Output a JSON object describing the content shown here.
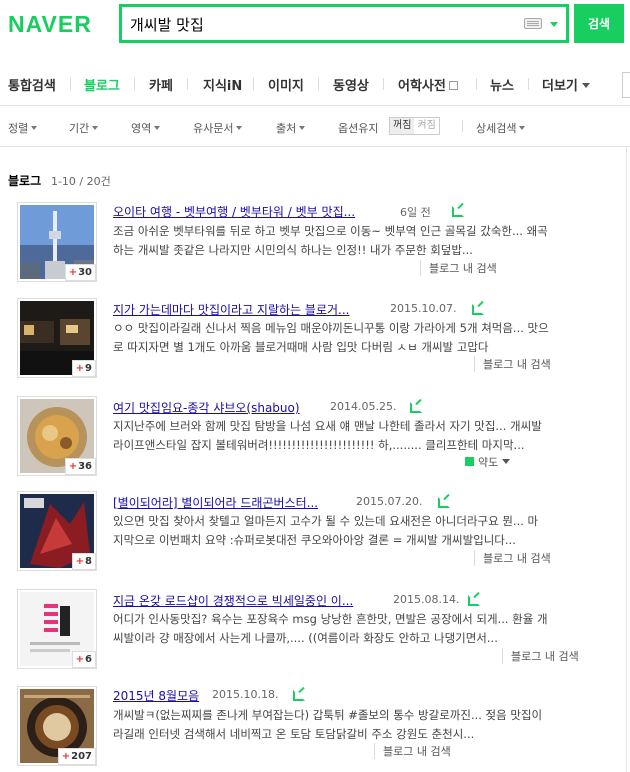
{
  "header": {
    "logo": "NAVER",
    "query": "개씨발 맛집",
    "search_button": "검색"
  },
  "tabs": [
    {
      "label": "통합검색"
    },
    {
      "label": "블로그",
      "active": true
    },
    {
      "label": "카페"
    },
    {
      "label": "지식iN"
    },
    {
      "label": "이미지"
    },
    {
      "label": "동영상"
    },
    {
      "label": "어학사전"
    },
    {
      "label": "뉴스"
    },
    {
      "label": "더보기"
    }
  ],
  "filters": {
    "sort": "정렬",
    "period": "기간",
    "area": "영역",
    "similar": "유사문서",
    "source": "출처",
    "option_label": "옵션유지",
    "option_off": "꺼짐",
    "option_on": "켜짐",
    "detail": "상세검색"
  },
  "section": {
    "title": "블로그",
    "count": "1-10 / 20건"
  },
  "results": [
    {
      "title": "오이타 여행 - 벳부여행 / 벳부타워 / 벳부 맛집...",
      "date": "6일 전",
      "desc1": "조금 아쉬운 벳부타워를 뒤로 하고 벳부 맛집으로 이동~ 벳부역 인근 골목길 갔숙한... 왜곡",
      "desc2": "하는 개씨발 좃같은 나라지만 시민의식 하나는 인정!! 내가 주문한 회덮밥...",
      "link": "블로그 내 검색",
      "count": "30"
    },
    {
      "title": "지가 가는데마다 맛집이라고 지랄하는 블로거...",
      "date": "2015.10.07.",
      "desc1": "ㅇㅇ 맛집이라길래 신나서 찍음 메뉴임 매운야끼돈니꾸통 이랑 가라아게 5개 쳐먹음... 맛으",
      "desc2": "로 따지자면 별 1개도 아까움 블로거때매 사람 입맛 다버림 ㅅㅂ 개씨발 고맙다",
      "link": "블로그 내 검색",
      "count": "9"
    },
    {
      "title": "여기 맛집임요-종각 샤브오(shabuo)",
      "date": "2014.05.25.",
      "desc1": "지지난주에 브러와 함께 맛집 탐방을 나섬 요새 얘 맨날 나한테 졸라서 자기 맛집... 개씨발",
      "desc2": "라이프앤스타일 잡지 볼테워버려!!!!!!!!!!!!!!!!!!!!!!! 하,........ 클리프한테 마지막...",
      "link": "약도",
      "count": "36"
    },
    {
      "title": "[별이되어라] 별이되어라 드래곤버스터...",
      "date": "2015.07.20.",
      "desc1": "있으면 맛집 찾아서 찾텔고 얼마든지 고수가 될 수 있는데 요새전은 아니더라구요 뭔... 마",
      "desc2": "지막으로 이번패치 요약 :슈퍼로봇대전 쿠오와아아앙 결론 = 개씨발 개씨발입니다...",
      "link": "블로그 내 검색",
      "count": "8"
    },
    {
      "title": "지금 온갖 로드샵이 경쟁적으로 빅세일중인 이...",
      "date": "2015.08.14.",
      "desc1": "어디가 인사동맛집? 육수는 포장육수 msg 낭낭한 흔한맛, 면발은 공장에서 되게... 환율 개",
      "desc2": "씨발이라 걍 매장에서 사는게 나클까,.... ((여름이라 화장도 안하고 나댕기면서...",
      "link": "블로그 내 검색",
      "count": "6"
    },
    {
      "title": "2015년 8월모음",
      "date": "2015.10.18.",
      "desc1": "개씨발ㅋ(없는찌찌를 존나게 부여잡는다) 갑툭튀 #졸보의 통수 방갈로까진... 젖음 맛집이",
      "desc2": "라길래 인터넷 검색해서 네비찍고 온 토담 토담닭갈비 주소 강원도 춘천시...",
      "link": "블로그 내 검색",
      "count": "207"
    }
  ]
}
